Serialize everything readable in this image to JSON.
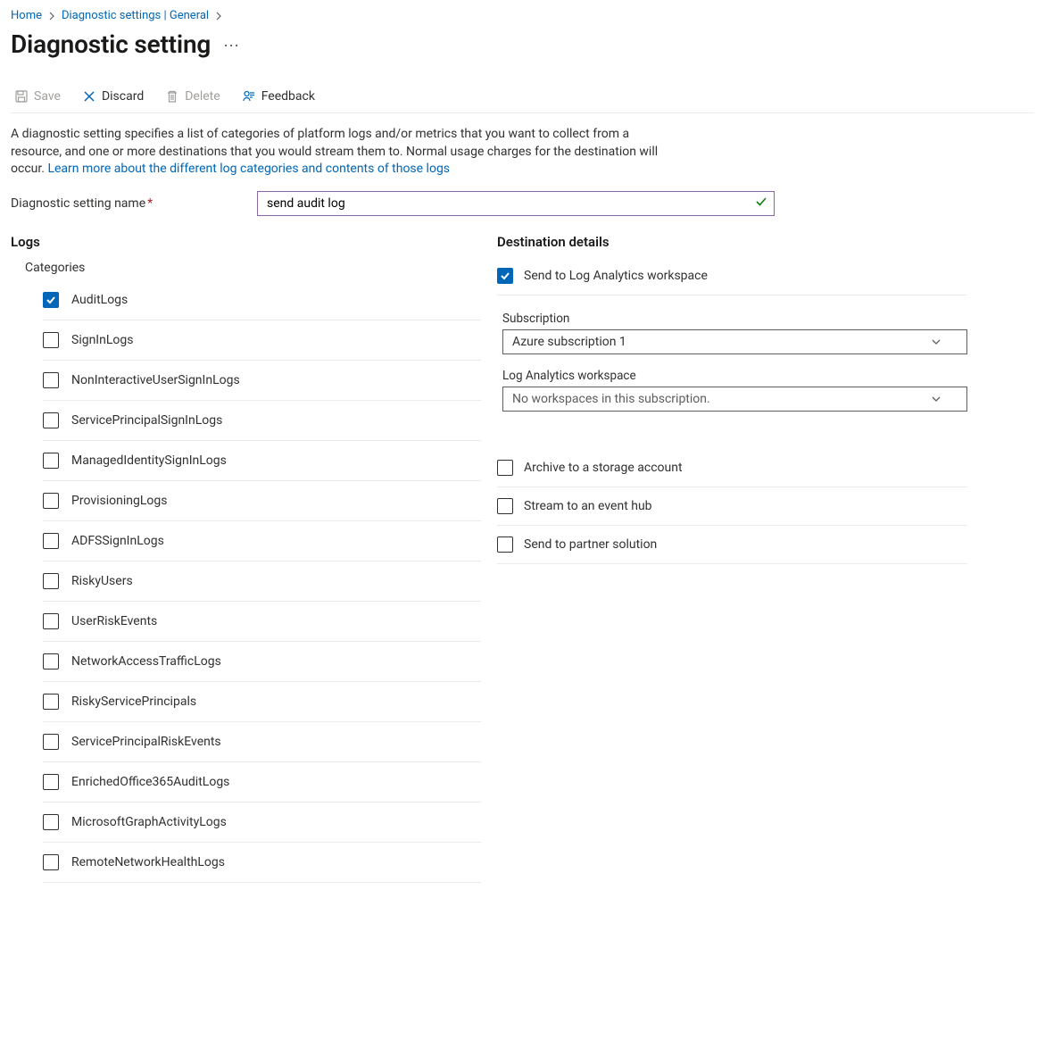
{
  "breadcrumb": {
    "home": "Home",
    "prev": "Diagnostic settings | General"
  },
  "page_title": "Diagnostic setting",
  "toolbar": {
    "save": "Save",
    "discard": "Discard",
    "delete": "Delete",
    "feedback": "Feedback"
  },
  "intro": {
    "text1": "A diagnostic setting specifies a list of categories of platform logs and/or metrics that you want to collect from a resource, and one or more destinations that you would stream them to. Normal usage charges for the destination will occur. ",
    "link": "Learn more about the different log categories and contents of those logs"
  },
  "name_field": {
    "label": "Diagnostic setting name",
    "value": "send audit log"
  },
  "logs": {
    "title": "Logs",
    "categories_label": "Categories",
    "categories": [
      {
        "label": "AuditLogs",
        "checked": true
      },
      {
        "label": "SignInLogs",
        "checked": false
      },
      {
        "label": "NonInteractiveUserSignInLogs",
        "checked": false
      },
      {
        "label": "ServicePrincipalSignInLogs",
        "checked": false
      },
      {
        "label": "ManagedIdentitySignInLogs",
        "checked": false
      },
      {
        "label": "ProvisioningLogs",
        "checked": false
      },
      {
        "label": "ADFSSignInLogs",
        "checked": false
      },
      {
        "label": "RiskyUsers",
        "checked": false
      },
      {
        "label": "UserRiskEvents",
        "checked": false
      },
      {
        "label": "NetworkAccessTrafficLogs",
        "checked": false
      },
      {
        "label": "RiskyServicePrincipals",
        "checked": false
      },
      {
        "label": "ServicePrincipalRiskEvents",
        "checked": false
      },
      {
        "label": "EnrichedOffice365AuditLogs",
        "checked": false
      },
      {
        "label": "MicrosoftGraphActivityLogs",
        "checked": false
      },
      {
        "label": "RemoteNetworkHealthLogs",
        "checked": false
      }
    ]
  },
  "destinations": {
    "title": "Destination details",
    "log_analytics": {
      "label": "Send to Log Analytics workspace",
      "checked": true,
      "subscription_label": "Subscription",
      "subscription_value": "Azure subscription 1",
      "workspace_label": "Log Analytics workspace",
      "workspace_value": "No workspaces in this subscription."
    },
    "storage": {
      "label": "Archive to a storage account",
      "checked": false
    },
    "event_hub": {
      "label": "Stream to an event hub",
      "checked": false
    },
    "partner": {
      "label": "Send to partner solution",
      "checked": false
    }
  }
}
